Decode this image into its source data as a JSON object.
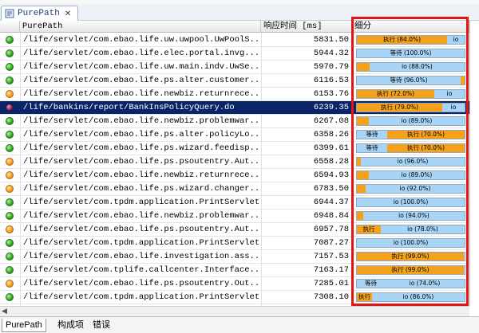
{
  "tab": {
    "title": "PurePath",
    "icon": "purepath-tab-icon"
  },
  "columns": {
    "path": "PurePath",
    "response": "响应时间 [ms]",
    "breakdown": "细分"
  },
  "rows": [
    {
      "status": "green",
      "path": "/life/servlet/com.ebao.life.uw.uwpool.UwPoolS...",
      "time": "5831.50",
      "segs": [
        {
          "t": "cpu",
          "w": 0.84,
          "label": "执行 (84.0%)"
        },
        {
          "t": "io",
          "w": 0.16,
          "label": "io"
        }
      ]
    },
    {
      "status": "green",
      "path": "/life/servlet/com.ebao.life.elec.portal.invg...",
      "time": "5944.32",
      "segs": [
        {
          "t": "io",
          "w": 1.0,
          "label": "等待 (100.0%)"
        }
      ]
    },
    {
      "status": "green",
      "path": "/life/servlet/com.ebao.life.uw.main.indv.UwSe...",
      "time": "5970.79",
      "segs": [
        {
          "t": "cpu",
          "w": 0.12,
          "label": ""
        },
        {
          "t": "io",
          "w": 0.88,
          "label": "io (88.0%)"
        }
      ]
    },
    {
      "status": "green",
      "path": "/life/servlet/com.ebao.life.ps.alter.customer...",
      "time": "6116.53",
      "segs": [
        {
          "t": "io",
          "w": 0.96,
          "label": "等待 (96.0%)"
        },
        {
          "t": "cpu",
          "w": 0.04,
          "label": ""
        }
      ]
    },
    {
      "status": "orange",
      "path": "/life/servlet/com.ebao.life.newbiz.returnrece...",
      "time": "6153.76",
      "segs": [
        {
          "t": "cpu",
          "w": 0.72,
          "label": "执行 (72.0%)"
        },
        {
          "t": "io",
          "w": 0.28,
          "label": "io"
        }
      ]
    },
    {
      "status": "purple",
      "path": "/life/bankins/report/BankInsPolicyQuery.do",
      "time": "6239.35",
      "segs": [
        {
          "t": "cpu",
          "w": 0.79,
          "label": "执行 (79.0%)"
        },
        {
          "t": "io",
          "w": 0.21,
          "label": "io"
        }
      ],
      "selected": true
    },
    {
      "status": "green",
      "path": "/life/servlet/com.ebao.life.newbiz.problemwar...",
      "time": "6267.08",
      "segs": [
        {
          "t": "cpu",
          "w": 0.11,
          "label": ""
        },
        {
          "t": "io",
          "w": 0.89,
          "label": "io (89.0%)"
        }
      ]
    },
    {
      "status": "green",
      "path": "/life/servlet/com.ebao.life.ps.alter.policyLo...",
      "time": "6358.26",
      "segs": [
        {
          "t": "io",
          "w": 0.28,
          "label": "等待"
        },
        {
          "t": "cpu",
          "w": 0.72,
          "label": "执行 (70.0%)"
        }
      ]
    },
    {
      "status": "green",
      "path": "/life/servlet/com.ebao.life.ps.wizard.feedisp...",
      "time": "6399.61",
      "segs": [
        {
          "t": "io",
          "w": 0.28,
          "label": "等待"
        },
        {
          "t": "cpu",
          "w": 0.72,
          "label": "执行 (70.0%)"
        }
      ]
    },
    {
      "status": "orange",
      "path": "/life/servlet/com.ebao.life.ps.psoutentry.Aut...",
      "time": "6558.28",
      "segs": [
        {
          "t": "cpu",
          "w": 0.04,
          "label": ""
        },
        {
          "t": "io",
          "w": 0.96,
          "label": "io (96.0%)"
        }
      ]
    },
    {
      "status": "orange",
      "path": "/life/servlet/com.ebao.life.newbiz.returnrece...",
      "time": "6594.93",
      "segs": [
        {
          "t": "cpu",
          "w": 0.11,
          "label": ""
        },
        {
          "t": "io",
          "w": 0.89,
          "label": "io (89.0%)"
        }
      ]
    },
    {
      "status": "orange",
      "path": "/life/servlet/com.ebao.life.ps.wizard.changer...",
      "time": "6783.50",
      "segs": [
        {
          "t": "cpu",
          "w": 0.08,
          "label": ""
        },
        {
          "t": "io",
          "w": 0.92,
          "label": "io (92.0%)"
        }
      ]
    },
    {
      "status": "green",
      "path": "/life/servlet/com.tpdm.application.PrintServlet",
      "time": "6944.37",
      "segs": [
        {
          "t": "io",
          "w": 1.0,
          "label": "io (100.0%)"
        }
      ]
    },
    {
      "status": "green",
      "path": "/life/servlet/com.ebao.life.newbiz.problemwar...",
      "time": "6948.84",
      "segs": [
        {
          "t": "cpu",
          "w": 0.06,
          "label": ""
        },
        {
          "t": "io",
          "w": 0.94,
          "label": "io (94.0%)"
        }
      ]
    },
    {
      "status": "orange",
      "path": "/life/servlet/com.ebao.life.ps.psoutentry.Aut...",
      "time": "6957.78",
      "segs": [
        {
          "t": "cpu",
          "w": 0.22,
          "label": "执行"
        },
        {
          "t": "io",
          "w": 0.78,
          "label": "io (78.0%)"
        }
      ]
    },
    {
      "status": "green",
      "path": "/life/servlet/com.tpdm.application.PrintServlet",
      "time": "7087.27",
      "segs": [
        {
          "t": "io",
          "w": 1.0,
          "label": "io (100.0%)"
        }
      ]
    },
    {
      "status": "green",
      "path": "/life/servlet/com.ebao.life.investigation.ass...",
      "time": "7157.53",
      "segs": [
        {
          "t": "cpu",
          "w": 0.99,
          "label": "执行 (99.0%)"
        },
        {
          "t": "io",
          "w": 0.01,
          "label": ""
        }
      ]
    },
    {
      "status": "green",
      "path": "/life/servlet/com.tplife.callcenter.Interface...",
      "time": "7163.17",
      "segs": [
        {
          "t": "cpu",
          "w": 0.99,
          "label": "执行 (99.0%)"
        },
        {
          "t": "io",
          "w": 0.01,
          "label": ""
        }
      ]
    },
    {
      "status": "orange",
      "path": "/life/servlet/com.ebao.life.ps.psoutentry.Out...",
      "time": "7285.01",
      "segs": [
        {
          "t": "io",
          "w": 0.26,
          "label": "等待"
        },
        {
          "t": "io",
          "w": 0.74,
          "label": "io (74.0%)"
        }
      ]
    },
    {
      "status": "green",
      "path": "/life/servlet/com.tpdm.application.PrintServlet",
      "time": "7308.10",
      "segs": [
        {
          "t": "cpu",
          "w": 0.14,
          "label": "执行"
        },
        {
          "t": "io",
          "w": 0.86,
          "label": "io (86.0%)"
        }
      ]
    }
  ],
  "bottom_tabs": [
    "PurePath",
    "构成项",
    "错误"
  ]
}
